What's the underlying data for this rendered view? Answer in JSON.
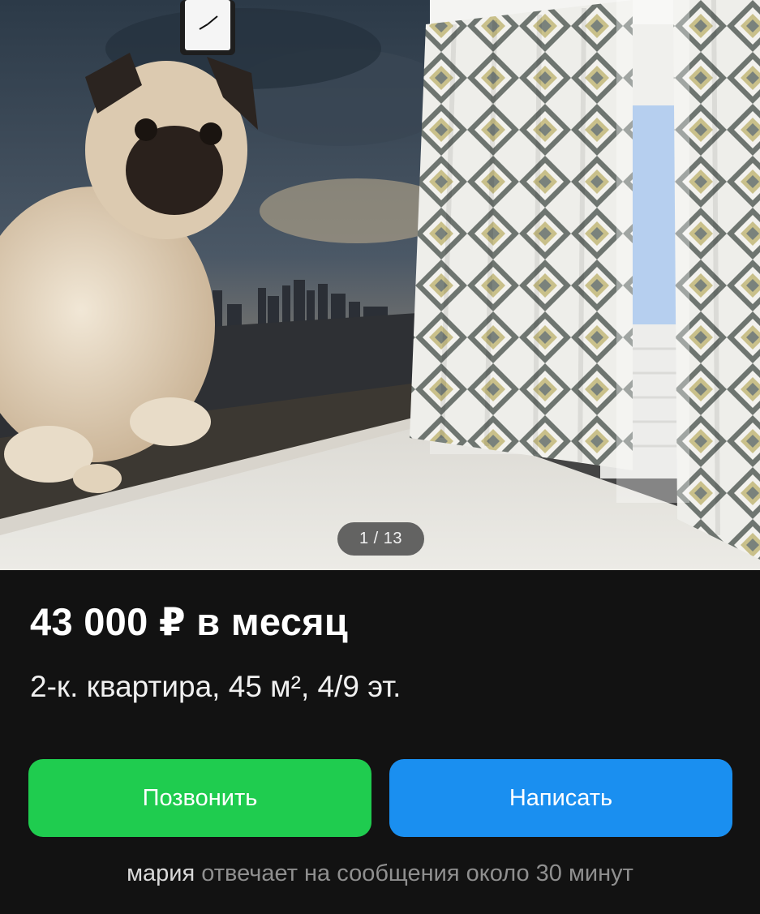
{
  "gallery": {
    "counter": "1 / 13",
    "photo_index": 1,
    "photo_total": 13
  },
  "listing": {
    "price": "43 000 ₽ в месяц",
    "subtitle": "2-к. квартира, 45 м², 4/9 эт."
  },
  "actions": {
    "call_label": "Позвонить",
    "write_label": "Написать"
  },
  "seller": {
    "name": "мария",
    "response_note": "отвечает на сообщения около 30 минут"
  },
  "colors": {
    "call_button": "#1fcc4f",
    "write_button": "#1a8ff0",
    "background": "#121212"
  }
}
